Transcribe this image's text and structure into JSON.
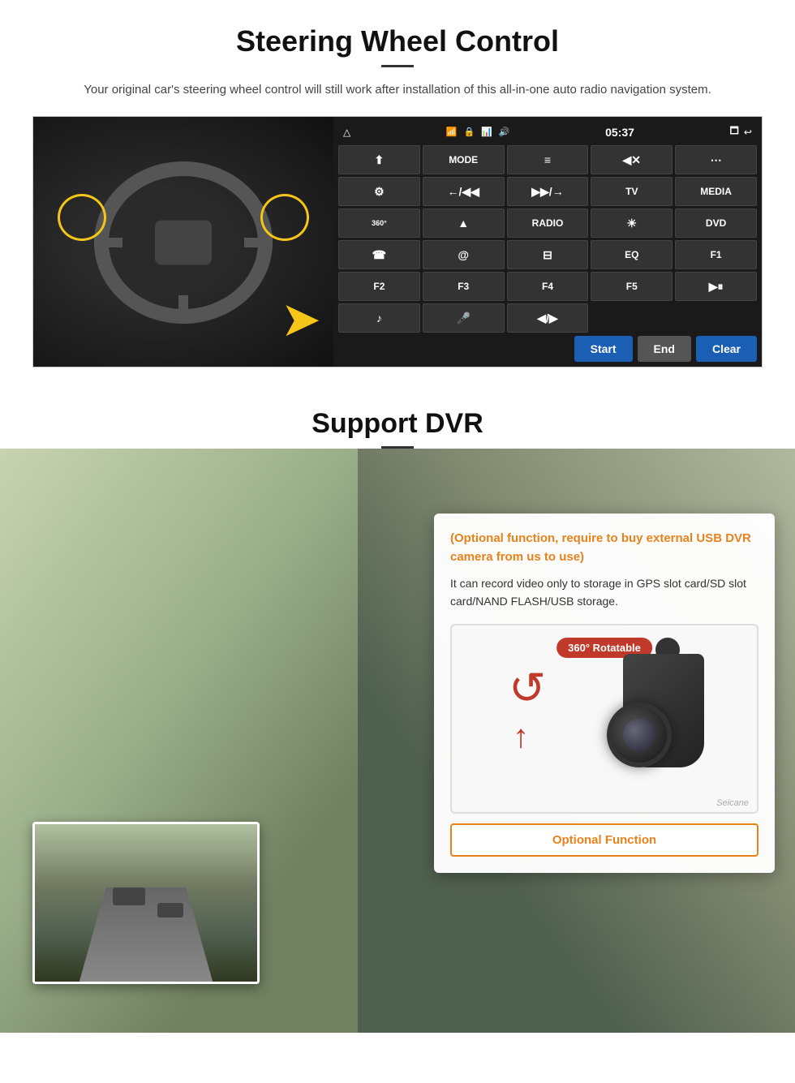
{
  "section1": {
    "title": "Steering Wheel Control",
    "description": "Your original car's steering wheel control will still work after installation of this all-in-one auto radio navigation system.",
    "time": "05:37",
    "radio_buttons": [
      {
        "label": "▷",
        "type": "dark",
        "row": 1,
        "col": 1
      },
      {
        "label": "MODE",
        "type": "dark",
        "row": 1,
        "col": 2
      },
      {
        "label": "☰",
        "type": "dark",
        "row": 1,
        "col": 3
      },
      {
        "label": "◀✕",
        "type": "dark",
        "row": 1,
        "col": 4
      },
      {
        "label": "⊙⊙⊙",
        "type": "dark",
        "row": 1,
        "col": 5
      },
      {
        "label": "⊙",
        "type": "dark",
        "row": 2,
        "col": 1
      },
      {
        "label": "←/◀◀",
        "type": "dark",
        "row": 2,
        "col": 2
      },
      {
        "label": "▶▶/→",
        "type": "dark",
        "row": 2,
        "col": 3
      },
      {
        "label": "TV",
        "type": "dark",
        "row": 2,
        "col": 4
      },
      {
        "label": "MEDIA",
        "type": "dark",
        "row": 2,
        "col": 5
      },
      {
        "label": "360",
        "type": "dark",
        "row": 3,
        "col": 1
      },
      {
        "label": "▲",
        "type": "dark",
        "row": 3,
        "col": 2
      },
      {
        "label": "RADIO",
        "type": "dark",
        "row": 3,
        "col": 3
      },
      {
        "label": "☀",
        "type": "dark",
        "row": 3,
        "col": 4
      },
      {
        "label": "DVD",
        "type": "dark",
        "row": 3,
        "col": 5
      },
      {
        "label": "☎",
        "type": "dark",
        "row": 4,
        "col": 1
      },
      {
        "label": "@",
        "type": "dark",
        "row": 4,
        "col": 2
      },
      {
        "label": "⊟",
        "type": "dark",
        "row": 4,
        "col": 3
      },
      {
        "label": "EQ",
        "type": "dark",
        "row": 4,
        "col": 4
      },
      {
        "label": "F1",
        "type": "dark",
        "row": 4,
        "col": 5
      },
      {
        "label": "F2",
        "type": "dark",
        "row": 5,
        "col": 1
      },
      {
        "label": "F3",
        "type": "dark",
        "row": 5,
        "col": 2
      },
      {
        "label": "F4",
        "type": "dark",
        "row": 5,
        "col": 3
      },
      {
        "label": "F5",
        "type": "dark",
        "row": 5,
        "col": 4
      },
      {
        "label": "▶⏸",
        "type": "dark",
        "row": 5,
        "col": 5
      },
      {
        "label": "♪",
        "type": "dark",
        "row": 6,
        "col": 1
      },
      {
        "label": "🎤",
        "type": "dark",
        "row": 6,
        "col": 2
      },
      {
        "label": "◀/▶",
        "type": "dark",
        "row": 6,
        "col": 3
      }
    ],
    "action_buttons": {
      "start": "Start",
      "end": "End",
      "clear": "Clear"
    }
  },
  "section2": {
    "title": "Support DVR",
    "optional_heading": "(Optional function, require to buy external USB DVR camera from us to use)",
    "description": "It can record video only to storage in GPS slot card/SD slot card/NAND FLASH/USB storage.",
    "badge_360": "360° Rotatable",
    "watermark": "Seicane",
    "optional_function_label": "Optional Function"
  }
}
